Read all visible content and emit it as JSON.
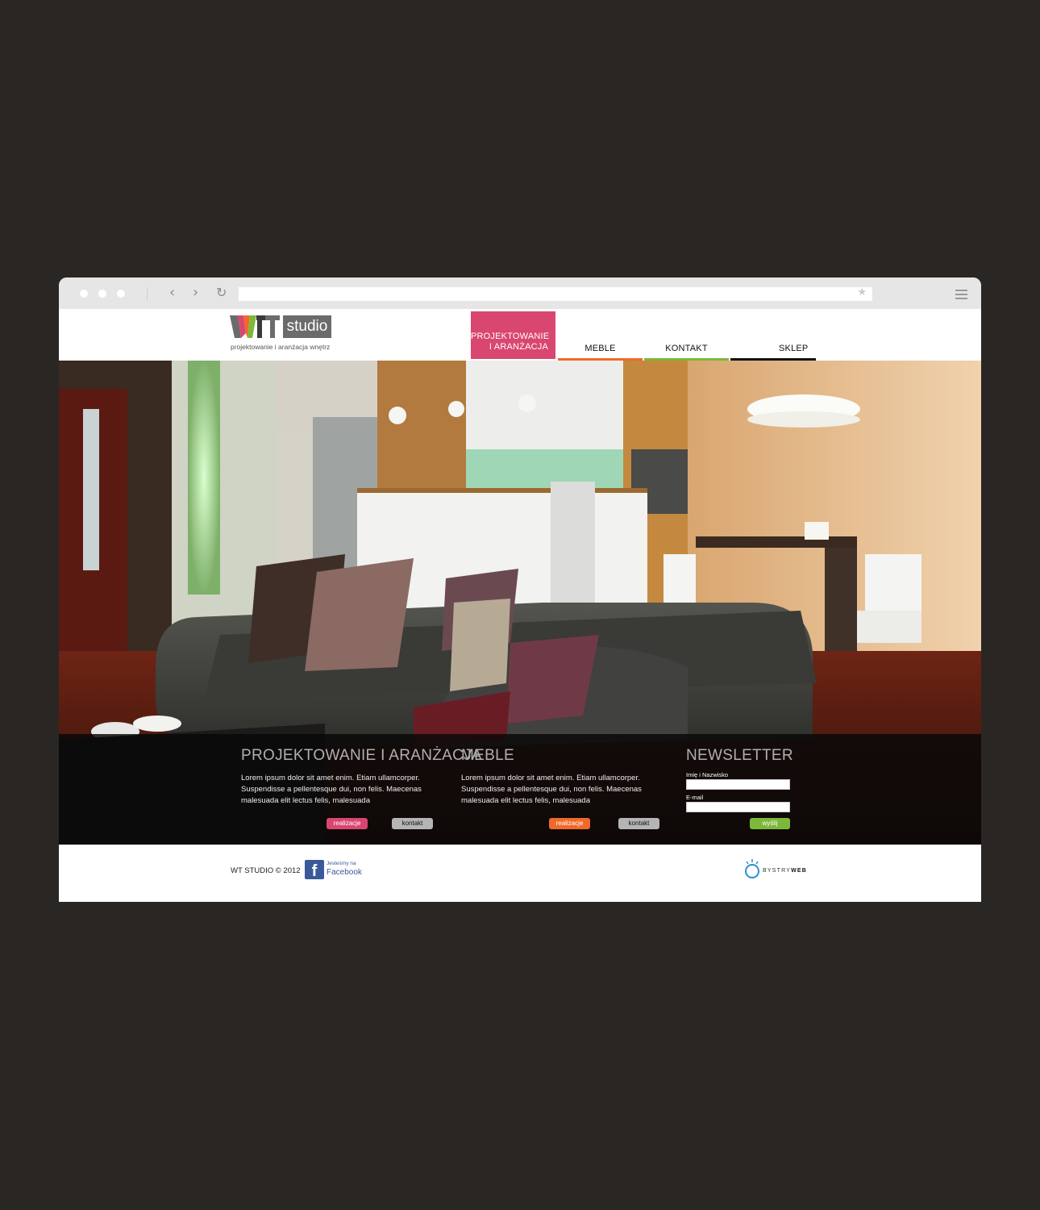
{
  "browser": {
    "back_icon": "chevron-left-icon",
    "forward_icon": "chevron-right-icon",
    "reload_icon": "reload-icon",
    "bookmark_icon": "star-icon",
    "menu_icon": "hamburger-icon",
    "url": ""
  },
  "logo": {
    "mark": "WT",
    "studio": "studio",
    "tagline": "projektowanie i aranżacja wnętrz"
  },
  "nav": {
    "items": [
      {
        "label": "Projektowanie i aranżacja",
        "color": "#d94670",
        "active": true
      },
      {
        "label": "Meble",
        "color": "#ef6a2a"
      },
      {
        "label": "Kontakt",
        "color": "#7cb83a"
      },
      {
        "label": "Sklep",
        "color": "#111111"
      }
    ]
  },
  "sections": {
    "projektowanie": {
      "title": "PROJEKTOWANIE I ARANŻACJA",
      "text": "Lorem ipsum dolor sit amet enim. Etiam ullamcorper. Suspendisse a pellentesque dui, non felis. Maecenas malesuada elit lectus felis, malesuada",
      "btn_realizacje": "realizacje",
      "btn_kontakt": "kontakt"
    },
    "meble": {
      "title": "MEBLE",
      "text": "Lorem ipsum dolor sit amet enim. Etiam ullamcorper. Suspendisse a pellentesque dui, non felis. Maecenas malesuada elit lectus felis, malesuada",
      "btn_realizacje": "realizacje",
      "btn_kontakt": "kontakt"
    },
    "newsletter": {
      "title": "NEWSLETTER",
      "name_label": "Imię i Nazwisko",
      "email_label": "E-mail",
      "name_value": "",
      "email_value": "",
      "submit": "wyślij"
    }
  },
  "footer": {
    "copyright": "WT STUDIO © 2012",
    "fb_small": "Jesteśmy na",
    "fb_big": "Facebook",
    "bystry_light": "BYSTRY",
    "bystry_bold": "WEB"
  },
  "colors": {
    "pink": "#d94670",
    "orange": "#ef6a2a",
    "green": "#7cb83a",
    "gray_btn": "#b5b5b5"
  }
}
